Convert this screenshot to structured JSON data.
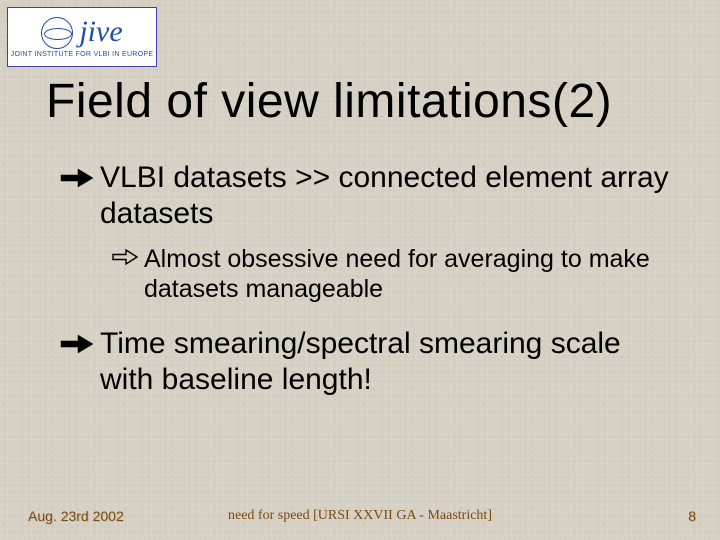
{
  "logo": {
    "word": "jive",
    "subtitle": "JOINT INSTITUTE FOR VLBI IN EUROPE"
  },
  "title": "Field of view limitations(2)",
  "bullets": {
    "b1a": "VLBI datasets >> connected element array datasets",
    "b2a": "Almost obsessive need for averaging to make datasets manageable",
    "b1b": "Time smearing/spectral smearing scale with baseline length!"
  },
  "footer": {
    "left": "Aug. 23rd 2002",
    "center": "need for speed [URSI XXVII GA - Maastricht]",
    "right": "8"
  }
}
